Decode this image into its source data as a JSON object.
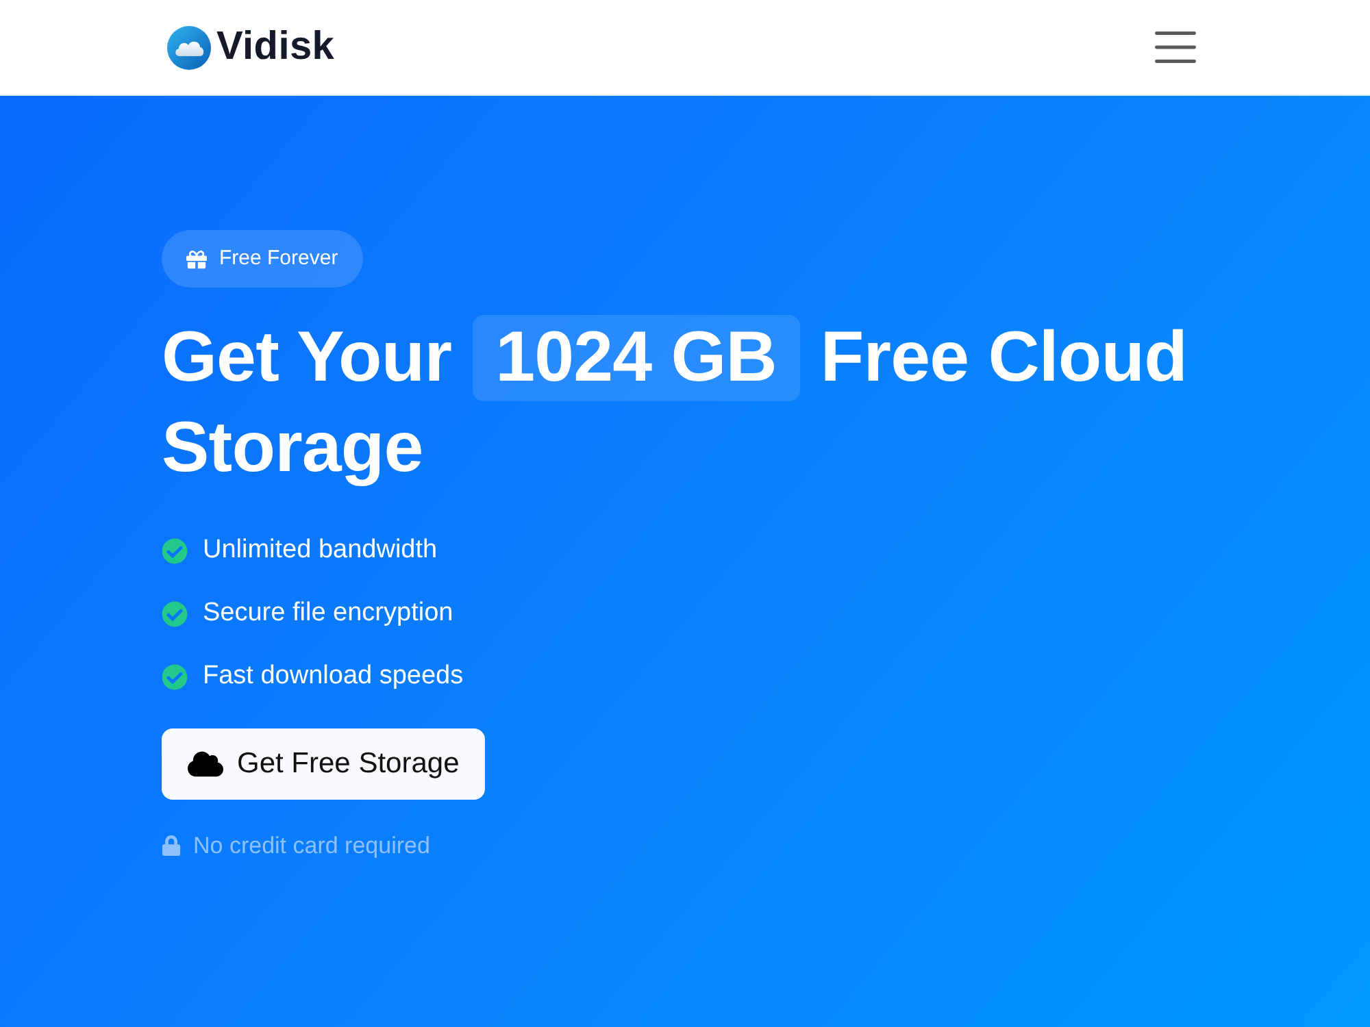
{
  "header": {
    "logo": {
      "text": "Vidisk"
    }
  },
  "hero": {
    "badge": {
      "label": "Free Forever"
    },
    "heading": {
      "line_1": {
        "before": "Get Your",
        "highlight": "1024 GB",
        "after": "Free Cloud"
      },
      "line_2": "Storage"
    },
    "features": [
      "Unlimited bandwidth",
      "Secure file encryption",
      "Fast download speeds"
    ],
    "cta_button": {
      "label": "Get Free Storage"
    },
    "note": {
      "text": "No credit card required"
    }
  }
}
